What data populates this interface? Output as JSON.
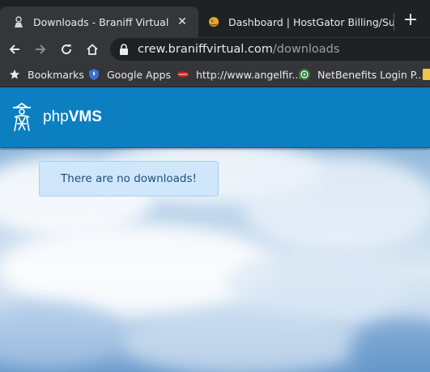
{
  "tabs": [
    {
      "title": "Downloads - Braniff Virtual",
      "active": true
    },
    {
      "title": "Dashboard | HostGator Billing/Su",
      "active": false
    }
  ],
  "address_bar": {
    "host": "crew.braniffvirtual.com",
    "path": "/downloads"
  },
  "bookmarks": [
    {
      "label": "Bookmarks",
      "icon": "star-icon"
    },
    {
      "label": "Google Apps",
      "icon": "google-apps-icon"
    },
    {
      "label": "http://www.angelfir...",
      "icon": "angelfire-icon"
    },
    {
      "label": "NetBenefits Login P...",
      "icon": "netbenefits-icon"
    }
  ],
  "site": {
    "brand_light": "php",
    "brand_bold": "VMS"
  },
  "alert": {
    "message": "There are no downloads!"
  },
  "colors": {
    "navbar": "#0b7fc0",
    "alert_bg": "#cfe6fb",
    "alert_text": "#1d4e7a"
  }
}
